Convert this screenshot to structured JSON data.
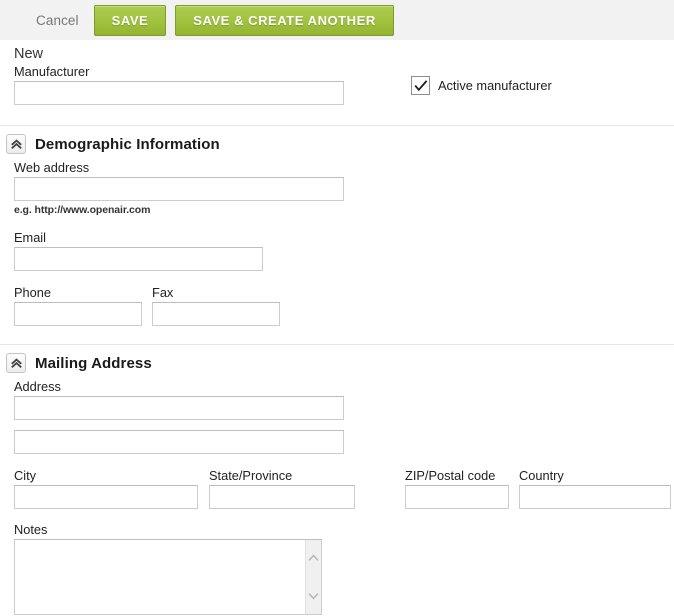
{
  "toolbar": {
    "cancel_label": "Cancel",
    "save_label": "SAVE",
    "save_create_label": "SAVE & CREATE ANOTHER",
    "accent_color": "#a3c442",
    "background_color": "#f2f2f2"
  },
  "record": {
    "status_title": "New",
    "name_label": "Manufacturer",
    "name_value": "",
    "active_checkbox": {
      "label": "Active manufacturer",
      "checked": true
    }
  },
  "sections": [
    {
      "title": "Demographic Information",
      "collapse_icon": "chevron-double-up-icon",
      "fields": [
        {
          "label": "Web address",
          "value": "",
          "hint": "e.g. http://www.openair.com"
        },
        {
          "label": "Email",
          "value": ""
        },
        {
          "label": "Phone",
          "value": ""
        },
        {
          "label": "Fax",
          "value": ""
        }
      ]
    },
    {
      "title": "Mailing Address",
      "collapse_icon": "chevron-double-up-icon",
      "fields": [
        {
          "label": "Address",
          "value": ""
        },
        {
          "label": "",
          "value": ""
        },
        {
          "label": "City",
          "value": ""
        },
        {
          "label": "State/Province",
          "value": ""
        },
        {
          "label": "ZIP/Postal code",
          "value": ""
        },
        {
          "label": "Country",
          "value": ""
        },
        {
          "label": "Notes",
          "value": ""
        }
      ]
    }
  ]
}
